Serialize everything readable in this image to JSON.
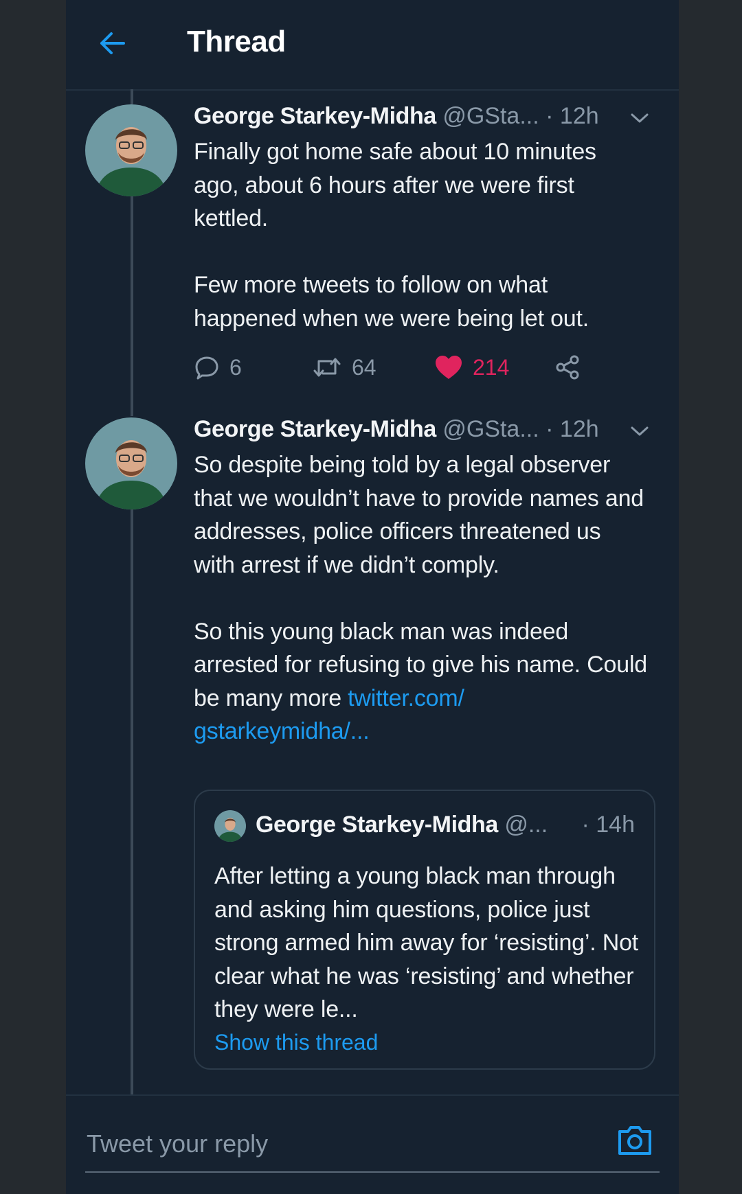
{
  "header": {
    "title": "Thread"
  },
  "tweets": [
    {
      "name": "George Starkey-Midha",
      "handle": "@GSta...",
      "dot": "·",
      "time": "12h",
      "paragraphs": [
        "Finally got home safe about 10 minutes ago, about 6 hours after we were first kettled.",
        "Few more tweets to follow on what happened when we were being let out."
      ],
      "replies": "6",
      "retweets": "64",
      "likes": "214"
    },
    {
      "name": "George Starkey-Midha",
      "handle": "@GSta...",
      "dot": "·",
      "time": "12h",
      "paragraph1": "So despite being told by a legal observer that we wouldn’t have to provide names and addresses, police officers threatened us with arrest if we didn’t comply.",
      "paragraph2_text": "So this young black man was indeed arrested for refusing to give his name. Could be many more ",
      "link_part1": "twitter.com/",
      "link_part2": "gstarkeymidha/..."
    }
  ],
  "quote": {
    "name": "George Starkey-Midha",
    "handle": "@...",
    "time": "· 14h",
    "text": "After letting a young black man through and asking him questions, police just strong armed him away for ‘resisting’. Not clear what he was ‘resisting’ and whether they were le...",
    "show_thread": "Show this thread"
  },
  "reply": {
    "placeholder": "Tweet your reply"
  },
  "colors": {
    "accent": "#1d9bf0",
    "like": "#e0245e",
    "background": "#162230"
  },
  "icons": [
    "back-arrow-icon",
    "chevron-down-icon",
    "reply-icon",
    "retweet-icon",
    "heart-icon",
    "share-icon",
    "camera-icon"
  ]
}
